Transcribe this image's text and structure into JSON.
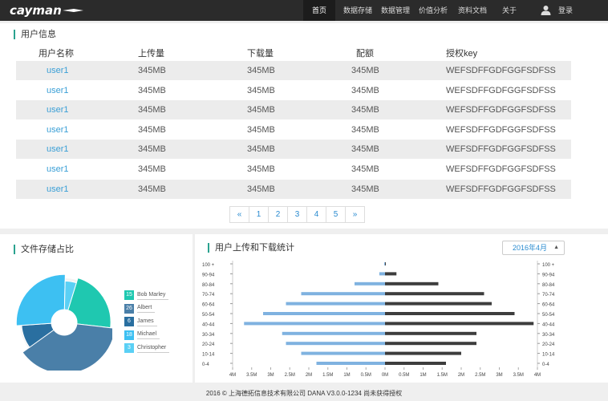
{
  "brand": "cayman",
  "nav": {
    "items": [
      {
        "label": "首页",
        "active": true
      },
      {
        "label": "数据存储",
        "active": false
      },
      {
        "label": "数据管理",
        "active": false
      },
      {
        "label": "价值分析",
        "active": false
      },
      {
        "label": "资料文档",
        "active": false
      },
      {
        "label": "关于",
        "active": false
      }
    ],
    "login_label": "登录"
  },
  "users_panel": {
    "title": "用户信息",
    "columns": [
      "用户名称",
      "上传量",
      "下载量",
      "配额",
      "授权key"
    ],
    "rows": [
      [
        "user1",
        "345MB",
        "345MB",
        "345MB",
        "WEFSDFFGDFGGFSDFSS"
      ],
      [
        "user1",
        "345MB",
        "345MB",
        "345MB",
        "WEFSDFFGDFGGFSDFSS"
      ],
      [
        "user1",
        "345MB",
        "345MB",
        "345MB",
        "WEFSDFFGDFGGFSDFSS"
      ],
      [
        "user1",
        "345MB",
        "345MB",
        "345MB",
        "WEFSDFFGDFGGFSDFSS"
      ],
      [
        "user1",
        "345MB",
        "345MB",
        "345MB",
        "WEFSDFFGDFGGFSDFSS"
      ],
      [
        "user1",
        "345MB",
        "345MB",
        "345MB",
        "WEFSDFFGDFGGFSDFSS"
      ],
      [
        "user1",
        "345MB",
        "345MB",
        "345MB",
        "WEFSDFFGDFGGFSDFSS"
      ]
    ],
    "pagination": [
      "«",
      "1",
      "2",
      "3",
      "4",
      "5",
      "»"
    ]
  },
  "storage_panel": {
    "title": "文件存储占比",
    "legend": [
      {
        "value": "15",
        "name": "Bob Marley",
        "color": "#1fc8b0"
      },
      {
        "value": "26",
        "name": "Albert",
        "color": "#4a7fa8"
      },
      {
        "value": "6",
        "name": "James",
        "color": "#2a6fa0"
      },
      {
        "value": "18",
        "name": "Michael",
        "color": "#3dc0f2"
      },
      {
        "value": "3",
        "name": "Christopher",
        "color": "#5ad0f5"
      }
    ]
  },
  "traffic_panel": {
    "title": "用户上传和下载统计",
    "month_select": "2016年4月"
  },
  "chart_data": {
    "type": "bar",
    "orientation": "horizontal-diverging",
    "categories": [
      "100 +",
      "90-94",
      "80-84",
      "70-74",
      "60-64",
      "50-54",
      "40-44",
      "30-34",
      "20-24",
      "10-14",
      "0-4"
    ],
    "series": [
      {
        "values": [
          0.02,
          0.15,
          0.8,
          2.2,
          2.6,
          3.2,
          3.7,
          2.7,
          2.6,
          2.2,
          1.8
        ],
        "color": "#7fb2e0"
      },
      {
        "values": [
          0.02,
          0.3,
          1.4,
          2.6,
          2.8,
          3.4,
          3.9,
          2.4,
          2.4,
          2.0,
          1.6
        ],
        "color": "#3d3d3d"
      }
    ],
    "x_ticks": [
      "4M",
      "3.5M",
      "3M",
      "2.5M",
      "2M",
      "1.5M",
      "1M",
      "0.5M",
      "0M",
      "0.5M",
      "1M",
      "1.5M",
      "2M",
      "2.5M",
      "3M",
      "3.5M",
      "4M"
    ],
    "xlim": [
      -4,
      4
    ]
  },
  "footer": "2016 © 上海德拓信息技术有限公司  DANA V3.0.0-1234  尚未获得授权"
}
